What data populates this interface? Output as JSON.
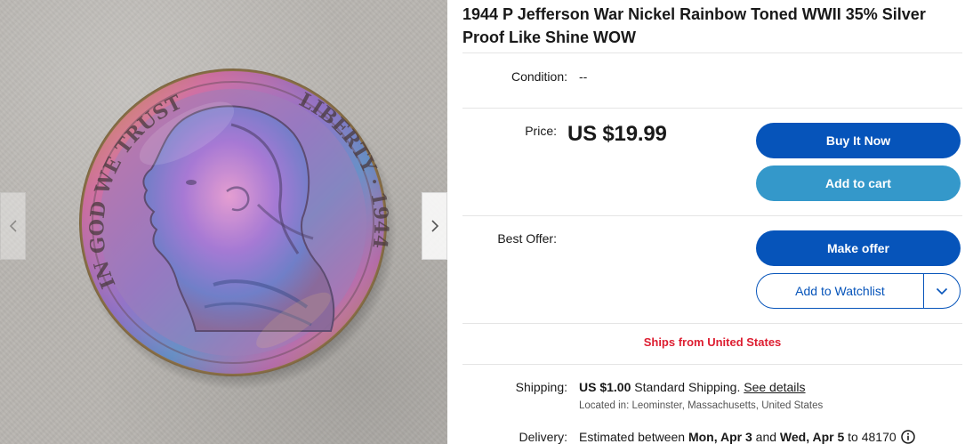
{
  "listing": {
    "title": "1944 P Jefferson War Nickel Rainbow Toned WWII 35% Silver Proof Like Shine WOW"
  },
  "gallery": {
    "image_subject": "coin-photo",
    "prev_icon": "chevron-left-icon",
    "next_icon": "chevron-right-icon"
  },
  "condition": {
    "label": "Condition:",
    "value": "--"
  },
  "price": {
    "label": "Price:",
    "value": "US $19.99"
  },
  "actions": {
    "buy_now": "Buy It Now",
    "add_to_cart": "Add to cart",
    "make_offer": "Make offer",
    "add_to_watchlist": "Add to Watchlist",
    "watchlist_menu_icon": "chevron-down-icon"
  },
  "best_offer": {
    "label": "Best Offer:"
  },
  "ships_from": "Ships from United States",
  "shipping": {
    "label": "Shipping:",
    "cost": "US $1.00",
    "method": "Standard Shipping.",
    "details_link": "See details",
    "located_in": "Located in: Leominster, Massachusetts, United States"
  },
  "delivery": {
    "label": "Delivery:",
    "prefix": "Estimated between",
    "start": "Mon, Apr 3",
    "and_text": "and",
    "end": "Wed, Apr 5",
    "to_text": "to 48170",
    "info_icon": "info-icon"
  },
  "colors": {
    "primary_button": "#0654ba",
    "secondary_button": "#3498ca",
    "ships_text": "#dd1e31",
    "divider": "#e5e5e5"
  }
}
